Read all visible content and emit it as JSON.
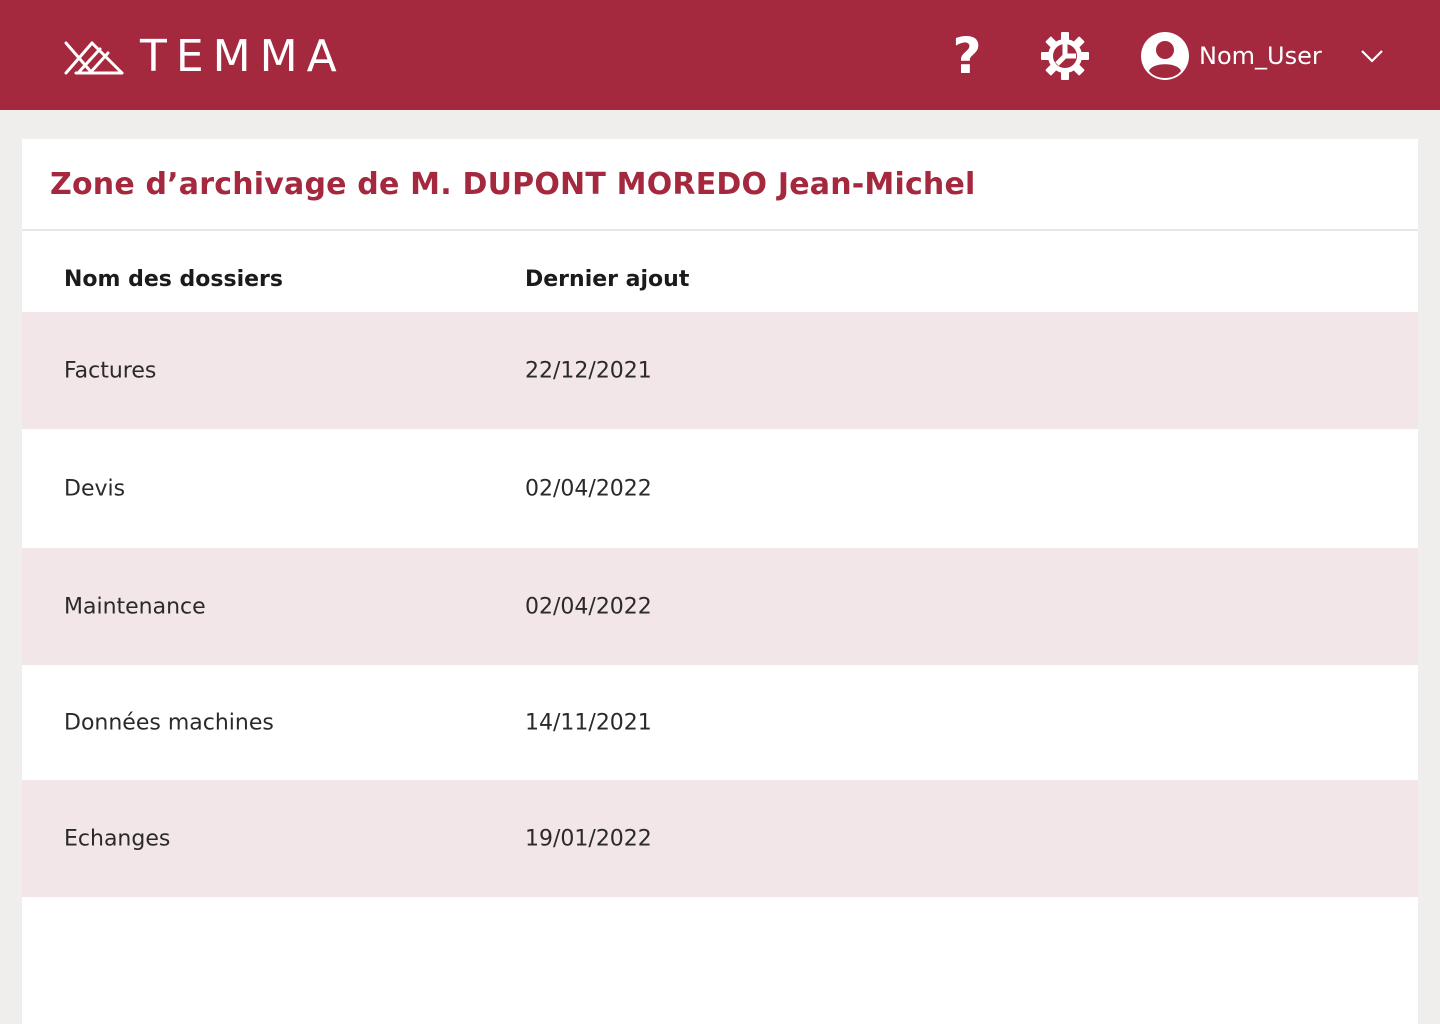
{
  "app": {
    "brand": "TEMMA",
    "colors": {
      "primary": "#a4283e",
      "row_alt": "#f3e6e8",
      "background": "#efeeec"
    }
  },
  "header": {
    "help_icon": "question-mark-icon",
    "help_glyph": "?",
    "settings_icon": "gear-icon",
    "user_icon": "avatar-icon",
    "user_name": "Nom_User",
    "menu_icon": "chevron-down-icon"
  },
  "main": {
    "title": "Zone d’archivage de M. DUPONT MOREDO Jean-Michel",
    "table": {
      "columns": [
        "Nom des dossiers",
        "Dernier ajout"
      ],
      "rows": [
        {
          "name": "Factures",
          "date": "22/12/2021"
        },
        {
          "name": "Devis",
          "date": "02/04/2022"
        },
        {
          "name": "Maintenance",
          "date": "02/04/2022"
        },
        {
          "name": "Données machines",
          "date": "14/11/2021"
        },
        {
          "name": "Echanges",
          "date": "19/01/2022"
        }
      ]
    }
  }
}
